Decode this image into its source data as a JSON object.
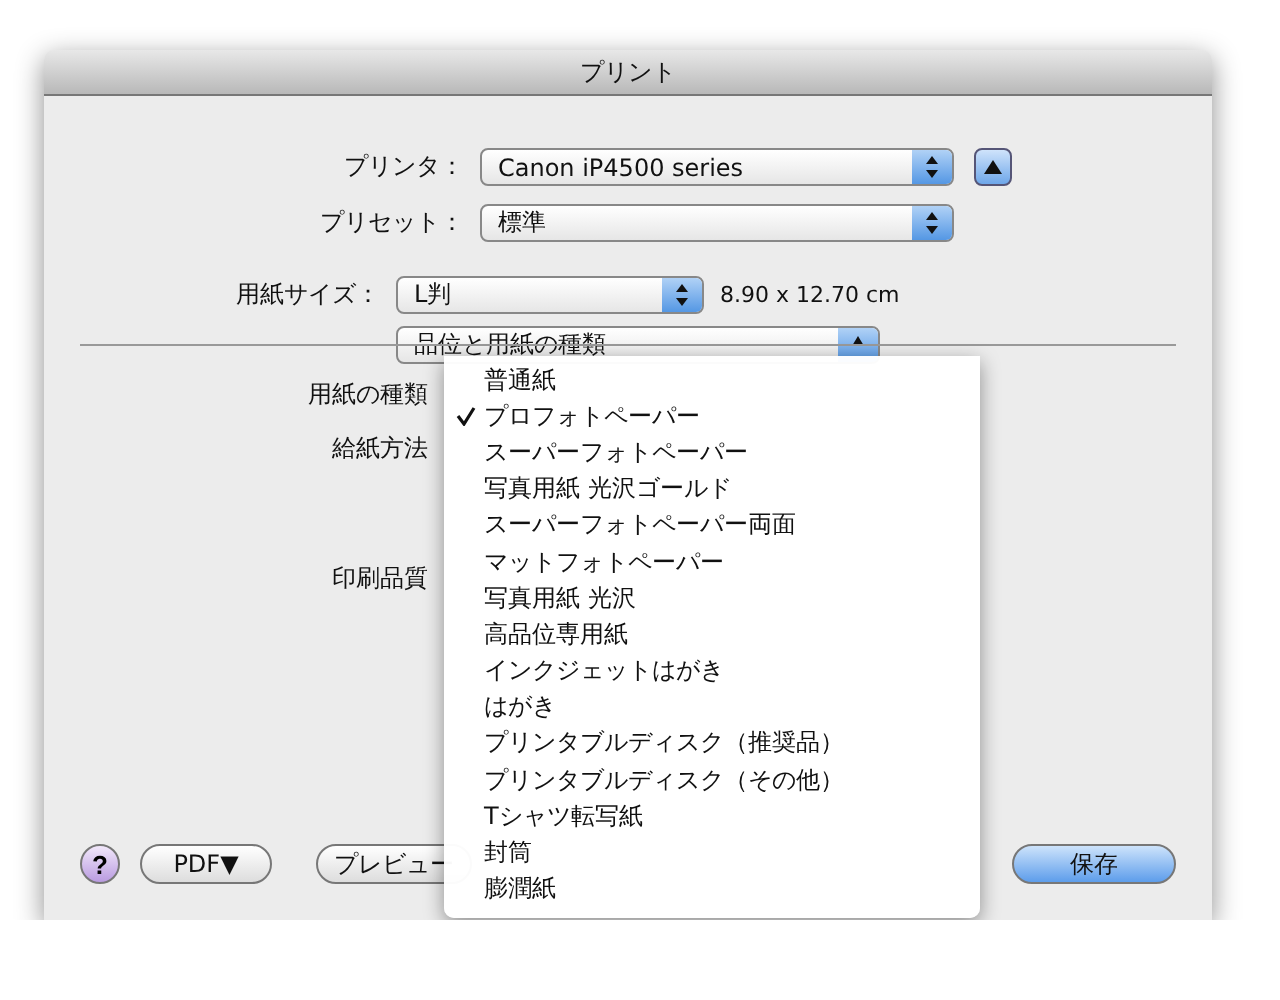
{
  "window": {
    "title": "プリント"
  },
  "printer": {
    "label": "プリンタ：",
    "value": "Canon iP4500 series"
  },
  "preset": {
    "label": "プリセット：",
    "value": "標準"
  },
  "paper_size": {
    "label": "用紙サイズ：",
    "value": "L判",
    "dimensions": "8.90 x 12.70 cm"
  },
  "panel_select": {
    "value": "品位と用紙の種類"
  },
  "settings_labels": [
    "用紙の種類",
    "給紙方法",
    "印刷品質"
  ],
  "menu": {
    "items": [
      {
        "label": "普通紙",
        "selected": false
      },
      {
        "label": "プロフォトペーパー",
        "selected": true
      },
      {
        "label": "スーパーフォトペーパー",
        "selected": false
      },
      {
        "label": "写真用紙 光沢ゴールド",
        "selected": false
      },
      {
        "label": "スーパーフォトペーパー両面",
        "selected": false
      },
      {
        "label": "マットフォトペーパー",
        "selected": false
      },
      {
        "label": "写真用紙 光沢",
        "selected": false
      },
      {
        "label": "高品位専用紙",
        "selected": false
      },
      {
        "label": "インクジェットはがき",
        "selected": false
      },
      {
        "label": "はがき",
        "selected": false
      },
      {
        "label": "プリンタブルディスク（推奨品）",
        "selected": false
      },
      {
        "label": "プリンタブルディスク（その他）",
        "selected": false
      },
      {
        "label": "Tシャツ転写紙",
        "selected": false
      },
      {
        "label": "封筒",
        "selected": false
      },
      {
        "label": "膨潤紙",
        "selected": false
      }
    ]
  },
  "footer": {
    "help": "?",
    "pdf": "PDF▼",
    "preview": "プレビュー",
    "save": "保存"
  }
}
